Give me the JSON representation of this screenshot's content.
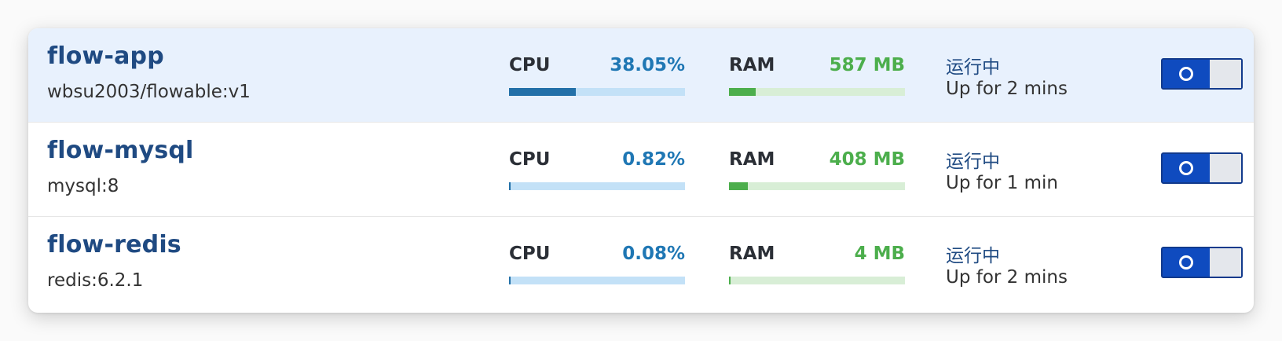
{
  "containers": [
    {
      "name": "flow-app",
      "image": "wbsu2003/flowable:v1",
      "cpu_label": "CPU",
      "cpu_value": "38.05%",
      "cpu_fraction": 0.3805,
      "ram_label": "RAM",
      "ram_value": "587 MB",
      "ram_fraction": 0.15,
      "status": "运行中",
      "uptime": "Up for 2 mins",
      "running": true,
      "highlighted": true
    },
    {
      "name": "flow-mysql",
      "image": "mysql:8",
      "cpu_label": "CPU",
      "cpu_value": "0.82%",
      "cpu_fraction": 0.0082,
      "ram_label": "RAM",
      "ram_value": "408 MB",
      "ram_fraction": 0.105,
      "status": "运行中",
      "uptime": "Up for 1 min",
      "running": true,
      "highlighted": false
    },
    {
      "name": "flow-redis",
      "image": "redis:6.2.1",
      "cpu_label": "CPU",
      "cpu_value": "0.08%",
      "cpu_fraction": 0.0008,
      "ram_label": "RAM",
      "ram_value": "4 MB",
      "ram_fraction": 0.001,
      "status": "运行中",
      "uptime": "Up for 2 mins",
      "running": true,
      "highlighted": false
    }
  ],
  "colors": {
    "name": "#1f4a82",
    "cpu_value": "#1f77b4",
    "cpu_fill": "#2370a8",
    "cpu_track": "#c3e1f7",
    "ram_value": "#4cae4c",
    "ram_fill": "#4cae4c",
    "ram_track": "#d8eed6",
    "toggle_on": "#0f4bbf",
    "row_highlight": "#e8f1fd"
  }
}
